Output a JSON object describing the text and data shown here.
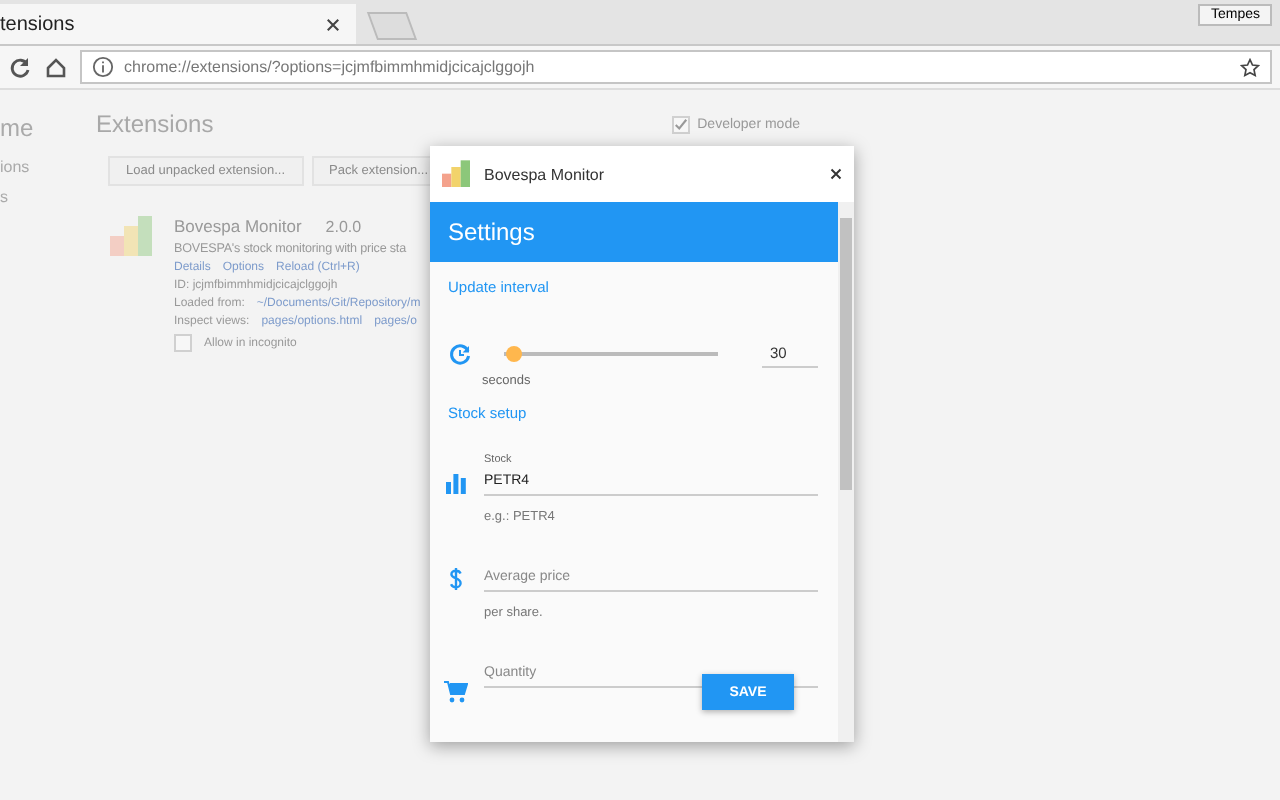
{
  "browser": {
    "tab": "tensions",
    "profile": "Tempes",
    "address": "chrome://extensions/?options=jcjmfbimmhmidjcicajclggojh"
  },
  "sidebar": {
    "title": "me",
    "items": [
      "ions",
      "s"
    ]
  },
  "page": {
    "title": "Extensions",
    "developer_mode": {
      "label": "Developer mode",
      "checked": true
    },
    "buttons": [
      "Load unpacked extension...",
      "Pack extension..."
    ]
  },
  "extension": {
    "name": "Bovespa Monitor",
    "version": "2.0.0",
    "description": "BOVESPA's stock monitoring with price sta",
    "links": [
      "Details",
      "Options",
      "Reload (Ctrl+R)"
    ],
    "id": "ID: jcjmfbimmhmidjcicajclggojh",
    "loaded_label": "Loaded from:",
    "loaded_path": "~/Documents/Git/Repository/m",
    "inspect_label": "Inspect views:",
    "inspect_links": [
      "pages/options.html",
      "pages/o"
    ],
    "incognito": {
      "label": "Allow in incognito",
      "checked": false
    }
  },
  "dialog": {
    "title": "Bovespa Monitor",
    "header": "Settings",
    "interval": {
      "heading": "Update interval",
      "level": 0.05,
      "value": "30",
      "unit": "seconds"
    },
    "stock_heading": "Stock setup",
    "fields": [
      {
        "kind": "chart",
        "label": "Stock",
        "value": "PETR4",
        "hint": "e.g.: PETR4"
      },
      {
        "kind": "dollar",
        "placeholder": "Average price",
        "hint": "per share."
      },
      {
        "kind": "cart",
        "placeholder": "Quantity"
      }
    ],
    "save": "SAVE"
  }
}
